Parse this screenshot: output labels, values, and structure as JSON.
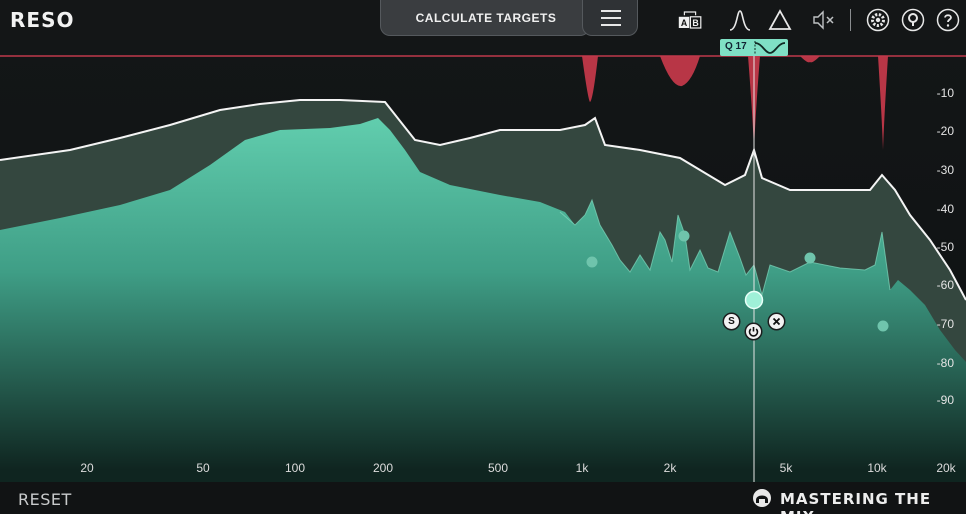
{
  "app": {
    "title": "RESO"
  },
  "toolbar": {
    "calculate_label": "CALCULATE TARGETS",
    "menu_icon": "hamburger-menu-icon",
    "icons": [
      "ab-compare-icon",
      "bell-filter-icon",
      "triangle-delta-icon",
      "mute-speaker-icon",
      "settings-gear-icon",
      "help-icon",
      "question-icon"
    ],
    "ab_a": "A",
    "ab_b": "B"
  },
  "band_tag": {
    "q_label": "Q 17",
    "shape_icon": "notch-filter-icon"
  },
  "node_buttons": {
    "solo": "S",
    "power_icon": "power-icon",
    "delete_icon": "close-icon"
  },
  "y_axis": {
    "labels": [
      "-10",
      "-20",
      "-30",
      "-40",
      "-50",
      "-60",
      "-70",
      "-80",
      "-90"
    ]
  },
  "x_axis": {
    "labels": [
      "20",
      "50",
      "100",
      "200",
      "500",
      "1k",
      "2k",
      "5k",
      "10k",
      "20k"
    ]
  },
  "footer": {
    "reset_label": "RESET",
    "brand": "MASTERING THE MIX"
  },
  "colors": {
    "accent": "#7fe0c5",
    "reduction": "#c0394b",
    "reference_line": "#c0394b",
    "spectrum_fill": "#4fb99e",
    "background": "#111314"
  }
}
